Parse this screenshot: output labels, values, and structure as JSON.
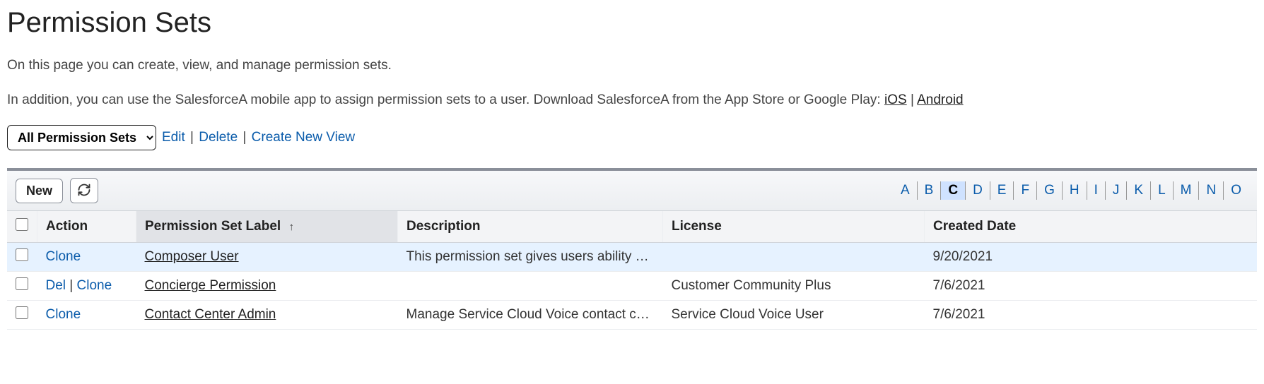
{
  "page": {
    "title": "Permission Sets",
    "intro1": "On this page you can create, view, and manage permission sets.",
    "intro2_pre": "In addition, you can use the SalesforceA mobile app to assign permission sets to a user. Download SalesforceA from the App Store or Google Play: ",
    "ios_label": "iOS",
    "sep": " | ",
    "android_label": "Android"
  },
  "view": {
    "selected": "All Permission Sets",
    "edit": "Edit",
    "delete": "Delete",
    "create": "Create New View"
  },
  "toolbar": {
    "new_label": "New"
  },
  "alpha": {
    "letters": [
      "A",
      "B",
      "C",
      "D",
      "E",
      "F",
      "G",
      "H",
      "I",
      "J",
      "K",
      "L",
      "M",
      "N",
      "O"
    ],
    "active": "C"
  },
  "columns": {
    "action": "Action",
    "label": "Permission Set Label",
    "description": "Description",
    "license": "License",
    "created": "Created Date",
    "sort_icon": "↑"
  },
  "rows": [
    {
      "selected": true,
      "actions": [
        "Clone"
      ],
      "label": "Composer User",
      "description": "This permission set gives users ability …",
      "license": "",
      "created": "9/20/2021"
    },
    {
      "selected": false,
      "actions": [
        "Del",
        "Clone"
      ],
      "label": "Concierge Permission",
      "description": "",
      "license": "Customer Community Plus",
      "created": "7/6/2021"
    },
    {
      "selected": false,
      "actions": [
        "Clone"
      ],
      "label": "Contact Center Admin",
      "description": "Manage Service Cloud Voice contact c…",
      "license": "Service Cloud Voice User",
      "created": "7/6/2021"
    }
  ]
}
